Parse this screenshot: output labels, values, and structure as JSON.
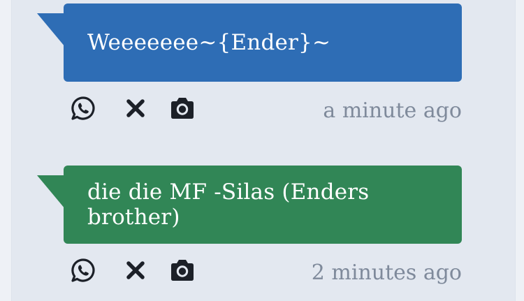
{
  "messages": [
    {
      "text": "Weeeeeee~{Ender}~",
      "timestamp": "a minute ago",
      "color": "#2e6db5",
      "icons": [
        "whatsapp-icon",
        "delete-x-icon",
        "camera-icon"
      ]
    },
    {
      "text": "die die MF -Silas (Enders brother)",
      "timestamp": "2 minutes ago",
      "color": "#318656",
      "icons": [
        "whatsapp-icon",
        "delete-x-icon",
        "camera-icon"
      ]
    }
  ]
}
